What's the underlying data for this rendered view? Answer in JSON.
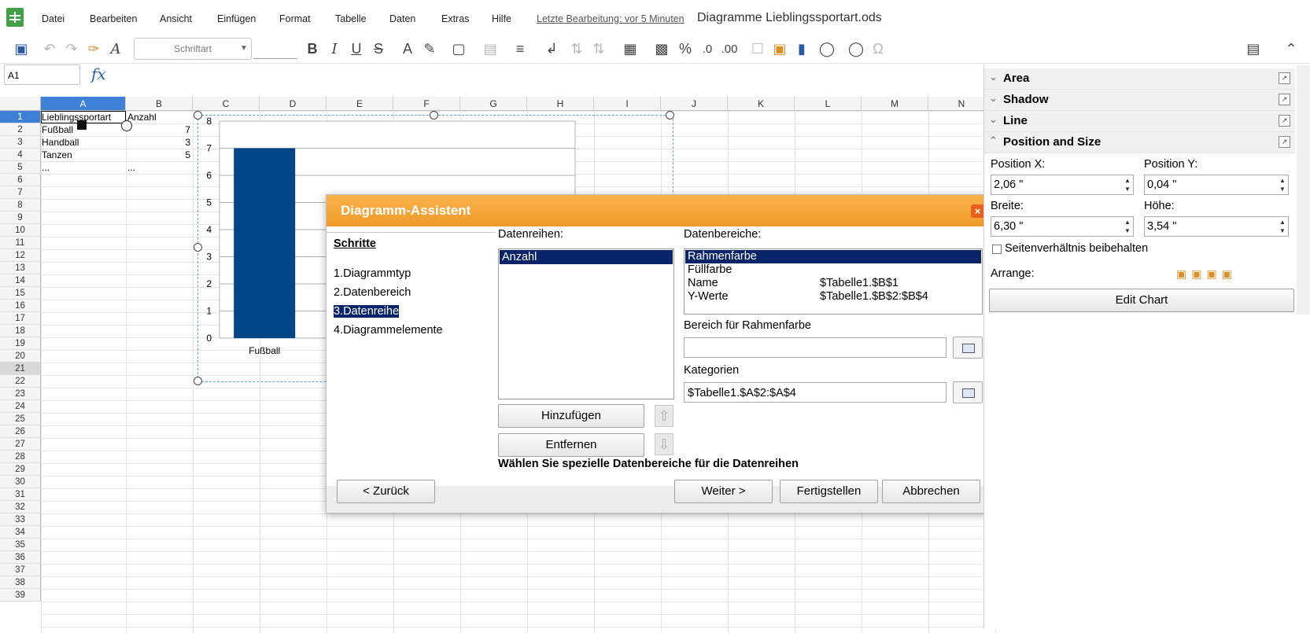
{
  "menubar": {
    "items": [
      "Datei",
      "Bearbeiten",
      "Ansicht",
      "Einfügen",
      "Format",
      "Tabelle",
      "Daten",
      "Extras",
      "Hilfe"
    ],
    "last_edit": "Letzte Bearbeitung: vor 5 Minuten",
    "document_title": "Diagramme Lieblingssportart.ods"
  },
  "toolbar": {
    "font_name_placeholder": "Schriftart",
    "icons": [
      "save-icon",
      "undo-icon",
      "redo-icon",
      "clone-formatting-icon",
      "clear-formatting-icon",
      "bold-icon",
      "italic-icon",
      "underline-icon",
      "strikethrough-icon",
      "font-color-icon",
      "highlight-icon",
      "borders-icon",
      "border-style-icon",
      "align-icon",
      "wrap-icon",
      "sort-ascending-icon",
      "sort-descending-icon",
      "conditional-format-icon",
      "image-icon",
      "percent-icon",
      "delete-decimal-icon",
      "add-decimal-icon",
      "comment-icon",
      "insert-image-icon",
      "insert-chart-icon",
      "shapes-icon",
      "hyperlink-icon",
      "special-character-icon",
      "sidebar-icon",
      "collapse-icon"
    ]
  },
  "formula_bar": {
    "name_box": "A1",
    "fx_label": "fx"
  },
  "sheet": {
    "columns": [
      "A",
      "B",
      "C",
      "D",
      "E",
      "F",
      "G",
      "H",
      "I",
      "J",
      "K",
      "L",
      "M",
      "N"
    ],
    "selected_column": "A",
    "selected_row": "1",
    "highlighted_row": "21",
    "rows": [
      "1",
      "2",
      "3",
      "4",
      "5",
      "6",
      "7",
      "8",
      "9",
      "10",
      "11",
      "12",
      "13",
      "14",
      "15",
      "16",
      "17",
      "18",
      "19",
      "20",
      "21",
      "22",
      "23",
      "24",
      "25",
      "26",
      "27",
      "28",
      "29",
      "30",
      "31",
      "32",
      "33",
      "34",
      "35",
      "36",
      "37",
      "38",
      "39"
    ],
    "cells": {
      "A1": "Lieblingssportart",
      "B1": "Anzahl",
      "A2": "Fußball",
      "B2": "7",
      "A3": "Handball",
      "B3": "3",
      "A4": "Tanzen",
      "B4": "5",
      "A5": "...",
      "B5": "..."
    }
  },
  "chart_data": {
    "type": "bar",
    "categories": [
      "Fußball"
    ],
    "series": [
      {
        "values": [
          7
        ]
      }
    ],
    "ylim": [
      0,
      8
    ],
    "yticks": [
      "0",
      "1",
      "2",
      "3",
      "4",
      "5",
      "6",
      "7",
      "8"
    ],
    "bar_color": "#004586",
    "grid": true
  },
  "dialog": {
    "title": "Diagramm-Assistent",
    "close_label": "×",
    "steps_title": "Schritte",
    "steps": [
      "1.Diagrammtyp",
      "2.Datenbereich",
      "3.Datenreihe",
      "4.Diagrammelemente"
    ],
    "active_step": 2,
    "series_label": "Datenreihen:",
    "series": [
      "Anzahl"
    ],
    "ranges_label": "Datenbereiche:",
    "ranges": [
      {
        "name": "Rahmenfarbe",
        "value": ""
      },
      {
        "name": "Füllfarbe",
        "value": ""
      },
      {
        "name": "Name",
        "value": "$Tabelle1.$B$1"
      },
      {
        "name": "Y-Werte",
        "value": "$Tabelle1.$B$2:$B$4"
      }
    ],
    "range_for_label": "Bereich für Rahmenfarbe",
    "range_for_value": "",
    "categories_label": "Kategorien",
    "categories_value": "$Tabelle1.$A$2:$A$4",
    "add_button": "Hinzufügen",
    "remove_button": "Entfernen",
    "hint": "Wählen Sie spezielle Datenbereiche für die Datenreihen",
    "back_button": "< Zurück",
    "next_button": "Weiter >",
    "finish_button": "Fertigstellen",
    "cancel_button": "Abbrechen"
  },
  "sidebar": {
    "sections": [
      "Area",
      "Shadow",
      "Line",
      "Position and Size"
    ],
    "position_x_label": "Position X:",
    "position_x_value": "2,06 \"",
    "position_y_label": "Position Y:",
    "position_y_value": "0,04 \"",
    "width_label": "Breite:",
    "width_value": "6,30 \"",
    "height_label": "Höhe:",
    "height_value": "3,54 \"",
    "keep_ratio_label": "Seitenverhältnis beibehalten",
    "keep_ratio_checked": false,
    "arrange_label": "Arrange:",
    "edit_chart_button": "Edit Chart"
  },
  "colors": {
    "dialog_title_bg": "#f5a53a",
    "selection": "#0a246a",
    "column_selected": "#3e80d6",
    "app_icon": "#43a047"
  }
}
